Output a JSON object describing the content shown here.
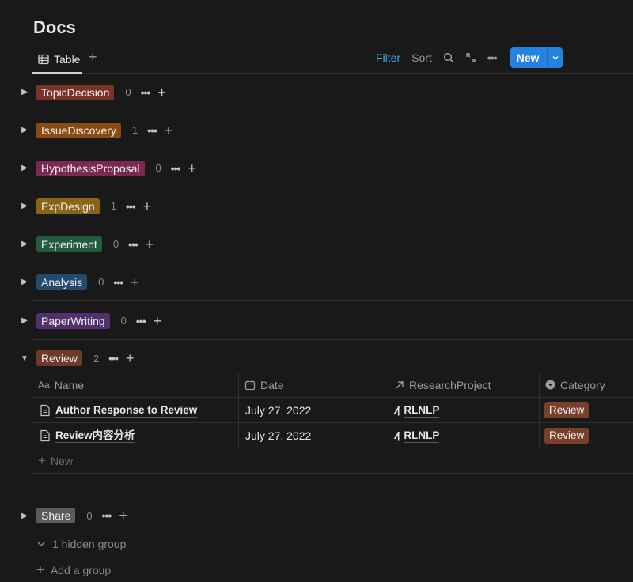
{
  "page": {
    "title": "Docs"
  },
  "toolbar": {
    "view_tab": "Table",
    "filter": "Filter",
    "sort": "Sort",
    "new": "New"
  },
  "groups": [
    {
      "label": "TopicDecision",
      "count": "0",
      "color": "#7a3328"
    },
    {
      "label": "IssueDiscovery",
      "count": "1",
      "color": "#8a4a12"
    },
    {
      "label": "HypothesisProposal",
      "count": "0",
      "color": "#7a2a52"
    },
    {
      "label": "ExpDesign",
      "count": "1",
      "color": "#8b6418"
    },
    {
      "label": "Experiment",
      "count": "0",
      "color": "#235c3e"
    },
    {
      "label": "Analysis",
      "count": "0",
      "color": "#254a6e"
    },
    {
      "label": "PaperWriting",
      "count": "0",
      "color": "#52306e"
    },
    {
      "label": "Review",
      "count": "2",
      "color": "#6e3a2a"
    }
  ],
  "table": {
    "columns": [
      "Name",
      "Date",
      "ResearchProject",
      "Category"
    ],
    "rows": [
      {
        "name": "Author Response to Review",
        "date": "July 27, 2022",
        "project": "RLNLP",
        "category": "Review"
      },
      {
        "name": "Review内容分析",
        "date": "July 27, 2022",
        "project": "RLNLP",
        "category": "Review"
      }
    ],
    "new_row": "New"
  },
  "share_group": {
    "label": "Share",
    "count": "0",
    "color": "#5a5a5a"
  },
  "footer": {
    "hidden_groups": "1 hidden group",
    "add_group": "Add a group"
  }
}
